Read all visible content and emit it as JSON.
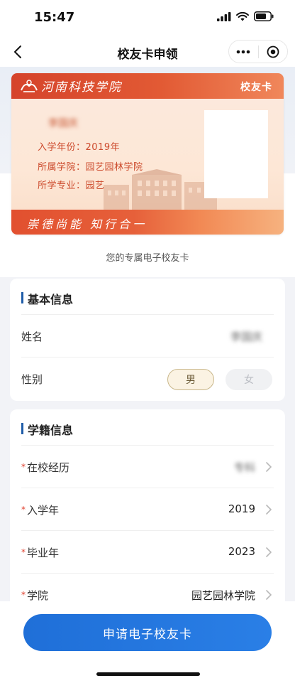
{
  "status": {
    "time": "15:47"
  },
  "nav": {
    "title": "校友卡申领"
  },
  "card": {
    "school_logo": "河南科技学院",
    "tag": "校友卡",
    "holder_name": "李国庆",
    "enroll_line": "入学年份：2019年",
    "college_line": "所属学院：园艺园林学院",
    "major_line": "所学专业：园艺",
    "slogan": "崇德尚能 知行合一"
  },
  "caption": "您的专属电子校友卡",
  "basic_info": {
    "title": "基本信息",
    "name_label": "姓名",
    "name_value": "李国庆",
    "gender_label": "性别",
    "gender_male": "男",
    "gender_female": "女",
    "selected_gender": "男"
  },
  "school_info": {
    "title": "学籍信息",
    "rows": [
      {
        "label": "在校经历",
        "value": "专科",
        "required": true
      },
      {
        "label": "入学年",
        "value": "2019",
        "required": true
      },
      {
        "label": "毕业年",
        "value": "2023",
        "required": true
      },
      {
        "label": "学院",
        "value": "园艺园林学院",
        "required": true
      }
    ],
    "required_mark": "*"
  },
  "apply_button": "申请电子校友卡",
  "colors": {
    "primary": "#2a7fe6",
    "card_red": "#d5432b",
    "accent_bar": "#1f5ca8"
  }
}
